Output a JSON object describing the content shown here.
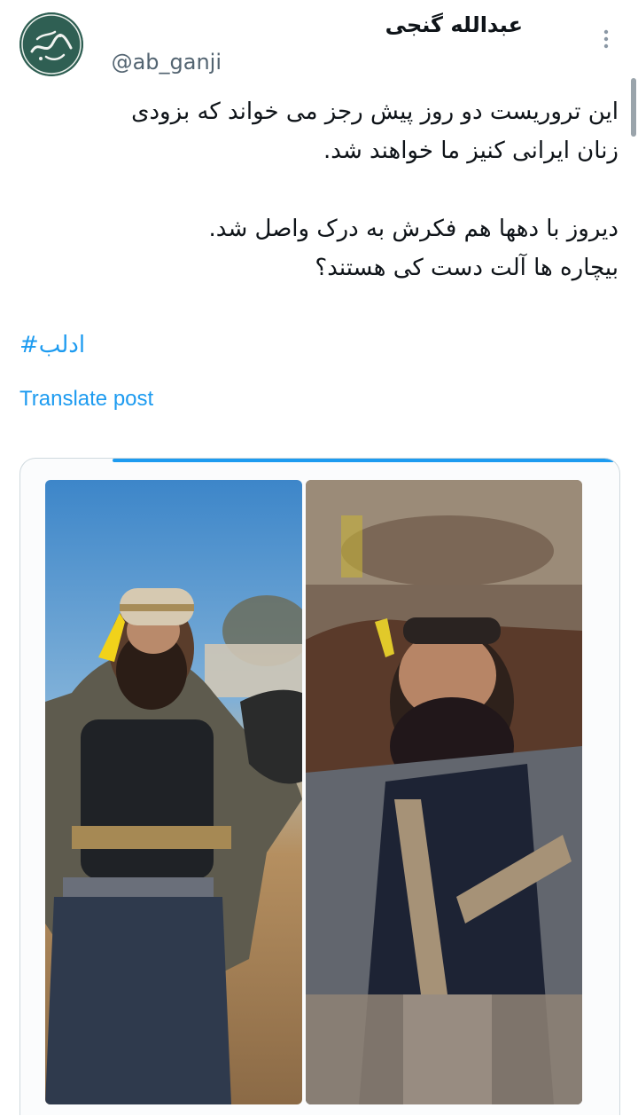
{
  "author": {
    "name": "عبدالله گنجی",
    "handle": "@ab_ganji",
    "avatar_icon": "calligraphy-logo"
  },
  "post": {
    "lines": [
      "این تروریست دو روز پیش رجز می خواند که بزودی",
      "زنان ایرانی کنیز ما خواهند شد.",
      "",
      "دیروز با دهها هم فکرش به درک واصل شد.",
      "بیچاره ها آلت دست کی هستند؟"
    ],
    "hashtag": "ادلب#",
    "translate_label": "Translate post"
  },
  "media": {
    "image_count": 2,
    "left_image_icon": "armed-man-photo",
    "right_image_icon": "dead-man-photo"
  },
  "colors": {
    "link": "#1d9bf0",
    "text": "#0f1419",
    "secondary": "#536471"
  }
}
